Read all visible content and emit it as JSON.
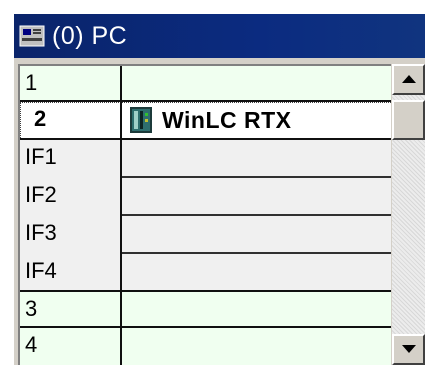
{
  "window": {
    "title": "(0) PC",
    "icon": "pc-station-icon"
  },
  "rack": {
    "rows": [
      {
        "slot": "1",
        "module": "",
        "kind": "slot"
      },
      {
        "slot": "2",
        "module": "WinLC RTX",
        "kind": "slot",
        "selected": true,
        "icon": "controller-module-icon"
      },
      {
        "slot": "IF1",
        "module": "",
        "kind": "interface"
      },
      {
        "slot": "IF2",
        "module": "",
        "kind": "interface"
      },
      {
        "slot": "IF3",
        "module": "",
        "kind": "interface"
      },
      {
        "slot": "IF4",
        "module": "",
        "kind": "interface"
      },
      {
        "slot": "3",
        "module": "",
        "kind": "slot"
      },
      {
        "slot": "4",
        "module": "",
        "kind": "slot"
      }
    ]
  },
  "scrollbar": {
    "up_icon": "scroll-up-arrow-icon",
    "down_icon": "scroll-down-arrow-icon"
  }
}
